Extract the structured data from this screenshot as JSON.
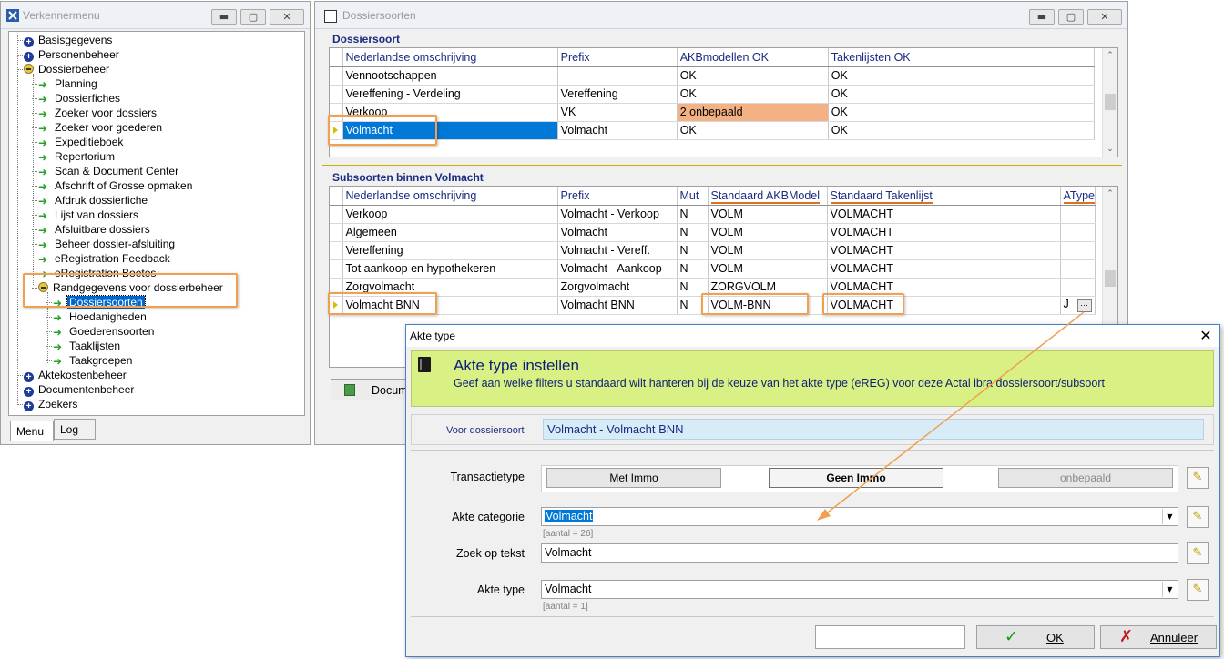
{
  "explorer": {
    "title": "Verkennermenu",
    "win_min": "▬",
    "win_max": "▢",
    "win_close": "✕",
    "tree": [
      {
        "label": "Basisgegevens",
        "icon": "plus"
      },
      {
        "label": "Personenbeheer",
        "icon": "plus"
      },
      {
        "label": "Dossierbeheer",
        "icon": "minus"
      },
      {
        "label": "Planning",
        "icon": "arrow"
      },
      {
        "label": "Dossierfiches",
        "icon": "arrow"
      },
      {
        "label": "Zoeker voor dossiers",
        "icon": "arrow"
      },
      {
        "label": "Zoeker voor goederen",
        "icon": "arrow"
      },
      {
        "label": "Expeditieboek",
        "icon": "arrow"
      },
      {
        "label": "Repertorium",
        "icon": "arrow"
      },
      {
        "label": "Scan & Document Center",
        "icon": "arrow"
      },
      {
        "label": "Afschrift of Grosse opmaken",
        "icon": "arrow"
      },
      {
        "label": "Afdruk dossierfiche",
        "icon": "arrow"
      },
      {
        "label": "Lijst van dossiers",
        "icon": "arrow"
      },
      {
        "label": "Afsluitbare dossiers",
        "icon": "arrow"
      },
      {
        "label": "Beheer dossier-afsluiting",
        "icon": "arrow"
      },
      {
        "label": "eRegistration Feedback",
        "icon": "arrow"
      },
      {
        "label": "eRegistration Boetes",
        "icon": "arrow"
      },
      {
        "label": "Randgegevens voor dossierbeheer",
        "icon": "minus"
      },
      {
        "label": "Dossiersoorten",
        "icon": "arrow"
      },
      {
        "label": "Hoedanigheden",
        "icon": "arrow"
      },
      {
        "label": "Goederensoorten",
        "icon": "arrow"
      },
      {
        "label": "Taaklijsten",
        "icon": "arrow"
      },
      {
        "label": "Taakgroepen",
        "icon": "arrow"
      },
      {
        "label": "Aktekostenbeheer",
        "icon": "plus"
      },
      {
        "label": "Documentenbeheer",
        "icon": "plus"
      },
      {
        "label": "Zoekers",
        "icon": "plus"
      }
    ],
    "tabs": [
      "Menu",
      "Log"
    ]
  },
  "dossiersoorten": {
    "title": "Dossiersoorten",
    "section1": "Dossiersoort",
    "grid1_headers": [
      "Nederlandse omschrijving",
      "Prefix",
      "AKBmodellen OK",
      "Takenlijsten OK"
    ],
    "grid1_rows": [
      [
        "Vennootschappen",
        "",
        "OK",
        "OK"
      ],
      [
        "Vereffening - Verdeling",
        "Vereffening",
        "OK",
        "OK"
      ],
      [
        "Verkoop",
        "VK",
        "2 onbepaald",
        "OK"
      ],
      [
        "Volmacht",
        "Volmacht",
        "OK",
        "OK"
      ]
    ],
    "section2": "Subsoorten binnen Volmacht",
    "grid2_headers": [
      "Nederlandse omschrijving",
      "Prefix",
      "Mut",
      "Standaard AKBModel",
      "Standaard Takenlijst",
      "AType"
    ],
    "grid2_rows": [
      [
        "Verkoop",
        "Volmacht - Verkoop",
        "N",
        "VOLM",
        "VOLMACHT",
        ""
      ],
      [
        "Algemeen",
        "Volmacht",
        "N",
        "VOLM",
        "VOLMACHT",
        ""
      ],
      [
        "Vereffening",
        "Volmacht - Vereff.",
        "N",
        "VOLM",
        "VOLMACHT",
        ""
      ],
      [
        "Tot aankoop en hypothekeren",
        "Volmacht - Aankoop",
        "N",
        "VOLM",
        "VOLMACHT",
        ""
      ],
      [
        "Zorgvolmacht",
        "Zorgvolmacht",
        "N",
        "ZORGVOLM",
        "VOLMACHT",
        ""
      ],
      [
        "Volmacht BNN",
        "Volmacht BNN",
        "N",
        "VOLM-BNN",
        "VOLMACHT",
        "J"
      ]
    ],
    "ellipsis": "···",
    "doc_button": "Docum"
  },
  "dialog": {
    "title": "Akte type",
    "close": "✕",
    "heading": "Akte type instellen",
    "subheading": "Geef aan welke filters u standaard wilt hanteren bij de keuze van het akte type (eREG) voor deze Actal ibra dossiersoort/subsoort",
    "voor_label": "Voor dossiersoort",
    "voor_value": "Volmacht - Volmacht BNN",
    "transactie_label": "Transactietype",
    "transactie_buttons": [
      "Met Immo",
      "Geen Immo",
      "onbepaald"
    ],
    "categorie_label": "Akte categorie",
    "categorie_value": "Volmacht",
    "categorie_count": "[aantal = 26]",
    "zoek_label": "Zoek op tekst",
    "zoek_value": "Volmacht",
    "type_label": "Akte type",
    "type_value": "Volmacht",
    "type_count": "[aantal = 1]",
    "ok": "OK",
    "cancel": "Annuleer"
  },
  "colors": {
    "selection": "#0078d7",
    "highlight_box": "#f0a050",
    "banner": "#d9f085",
    "warn_cell": "#f4b183",
    "header_text": "#1a2b80"
  }
}
